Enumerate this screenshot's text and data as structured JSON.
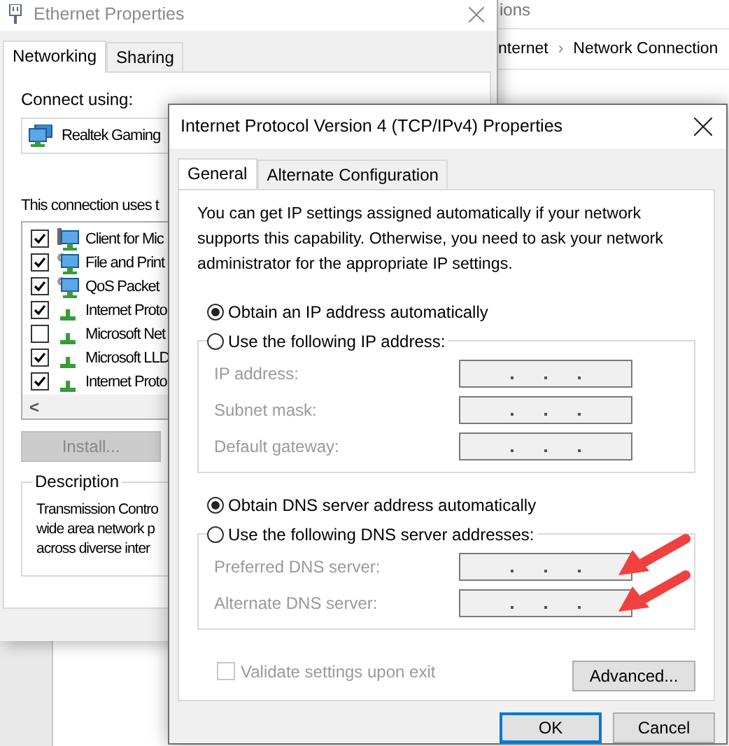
{
  "explorer": {
    "title": "ions",
    "breadcrumb": [
      "nternet",
      "Network Connection"
    ],
    "breadcrumb_separator": "›"
  },
  "ethernet_properties": {
    "title": "Ethernet Properties",
    "tabs": [
      {
        "label": "Networking",
        "selected": true
      },
      {
        "label": "Sharing",
        "selected": false
      }
    ],
    "connect_using_label": "Connect using:",
    "adapter": "Realtek Gaming",
    "components_label": "This connection uses t",
    "components": [
      {
        "label": "Client for Mic",
        "checked": true,
        "kind": "client"
      },
      {
        "label": "File and Print",
        "checked": true,
        "kind": "service"
      },
      {
        "label": "QoS Packet",
        "checked": true,
        "kind": "service"
      },
      {
        "label": "Internet Proto",
        "checked": true,
        "kind": "protocol"
      },
      {
        "label": "Microsoft Net",
        "checked": false,
        "kind": "protocol"
      },
      {
        "label": "Microsoft LLD",
        "checked": true,
        "kind": "protocol"
      },
      {
        "label": "Internet Proto",
        "checked": true,
        "kind": "protocol"
      }
    ],
    "scroll_left": "<",
    "install_button": {
      "label": "Install...",
      "disabled": true
    },
    "description": {
      "title": "Description",
      "lines": [
        "Transmission Contro",
        "wide area network p",
        "across diverse inter"
      ]
    }
  },
  "ipv4_properties": {
    "title": "Internet Protocol Version 4 (TCP/IPv4) Properties",
    "tabs": [
      {
        "label": "General",
        "selected": true
      },
      {
        "label": "Alternate Configuration",
        "selected": false
      }
    ],
    "intro": "You can get IP settings assigned automatically if your network supports this capability. Otherwise, you need to ask your network administrator for the appropriate IP settings.",
    "ip_options": [
      {
        "label": "Obtain an IP address automatically",
        "selected": true
      },
      {
        "label": "Use the following IP address:",
        "selected": false
      }
    ],
    "ip_fields": [
      {
        "label": "IP address:",
        "disabled": true,
        "highlighted": false
      },
      {
        "label": "Subnet mask:",
        "disabled": true,
        "highlighted": false
      },
      {
        "label": "Default gateway:",
        "disabled": true,
        "highlighted": false
      }
    ],
    "dns_options": [
      {
        "label": "Obtain DNS server address automatically",
        "selected": true
      },
      {
        "label": "Use the following DNS server addresses:",
        "selected": false
      }
    ],
    "dns_fields": [
      {
        "label": "Preferred DNS server:",
        "disabled": true,
        "highlighted": true
      },
      {
        "label": "Alternate DNS server:",
        "disabled": true,
        "highlighted": true
      }
    ],
    "validate": {
      "label": "Validate settings upon exit",
      "checked": false,
      "disabled": true
    },
    "advanced_button": "Advanced...",
    "buttons": [
      {
        "label": "OK",
        "default": true
      },
      {
        "label": "Cancel",
        "default": false
      }
    ]
  }
}
